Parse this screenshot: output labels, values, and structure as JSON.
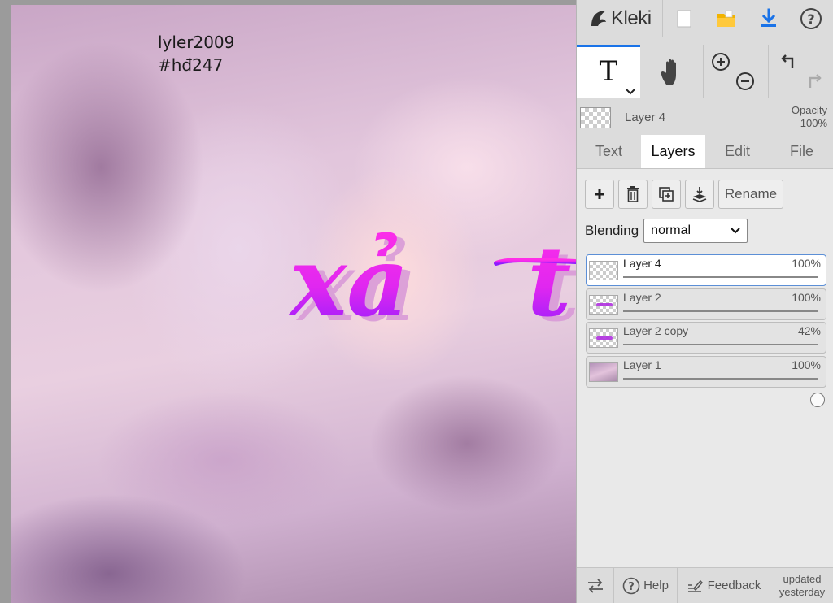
{
  "canvas": {
    "note": "lyler2009\n#hđ247",
    "art_text_left": "xả",
    "art_text_right": "t"
  },
  "app": {
    "name": "Kleki"
  },
  "topbar": {
    "icons": [
      "new-image-icon",
      "open-folder-icon",
      "download-icon",
      "help-icon"
    ]
  },
  "tools": {
    "text_tool_glyph": "T",
    "icons": [
      "text-tool-icon",
      "hand-tool-icon",
      "zoom-in-icon",
      "zoom-out-icon",
      "undo-icon",
      "redo-icon"
    ]
  },
  "current_layer": {
    "name": "Layer 4",
    "opacity_label": "Opacity",
    "opacity_value": "100%"
  },
  "tabs": [
    {
      "label": "Text",
      "active": false
    },
    {
      "label": "Layers",
      "active": true
    },
    {
      "label": "Edit",
      "active": false
    },
    {
      "label": "File",
      "active": false
    }
  ],
  "layer_actions": {
    "rename_label": "Rename"
  },
  "blending": {
    "label": "Blending",
    "value": "normal"
  },
  "layers": [
    {
      "name": "Layer 4",
      "opacity": "100%",
      "opacity_fraction": 1.0,
      "active": true
    },
    {
      "name": "Layer 2",
      "opacity": "100%",
      "opacity_fraction": 1.0,
      "active": false
    },
    {
      "name": "Layer 2 copy",
      "opacity": "42%",
      "opacity_fraction": 0.42,
      "active": false
    },
    {
      "name": "Layer 1",
      "opacity": "100%",
      "opacity_fraction": 1.0,
      "active": false
    }
  ],
  "bottom": {
    "help_label": "Help",
    "feedback_label": "Feedback",
    "updated_line1": "updated",
    "updated_line2": "yesterday"
  },
  "colors": {
    "accent": "#1a73e8",
    "download": "#1a73e8",
    "folder": "#f2b300",
    "art_magenta": "#ff2ee8",
    "art_violet": "#9a1cff",
    "art_shadow": "#d99bd8"
  }
}
